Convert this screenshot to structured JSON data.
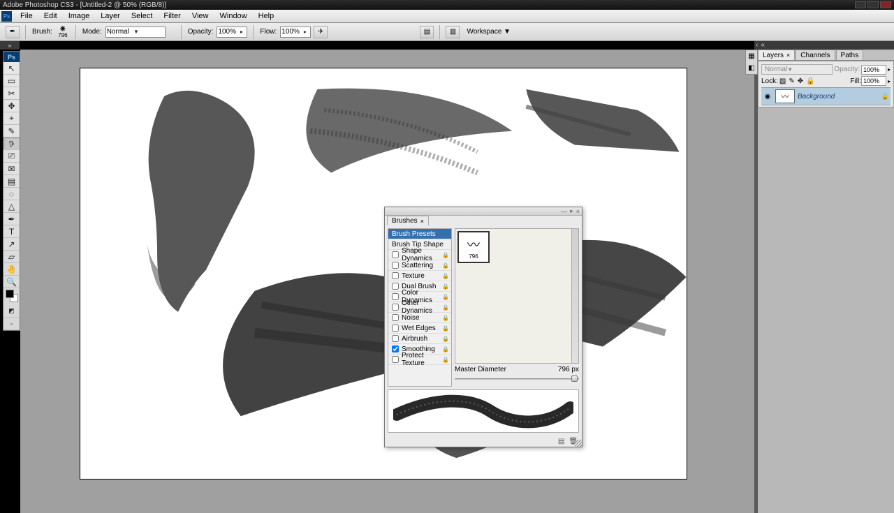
{
  "window": {
    "title": "Adobe Photoshop CS3 - [Untitled-2 @ 50% (RGB/8)]"
  },
  "menu": {
    "items": [
      "File",
      "Edit",
      "Image",
      "Layer",
      "Select",
      "Filter",
      "View",
      "Window",
      "Help"
    ]
  },
  "options": {
    "brush_label": "Brush:",
    "brush_size": "796",
    "mode_label": "Mode:",
    "mode_value": "Normal",
    "opacity_label": "Opacity:",
    "opacity_value": "100%",
    "flow_label": "Flow:",
    "flow_value": "100%",
    "workspace_label": "Workspace"
  },
  "toolbox": {
    "head": "Ps",
    "tools": [
      "↖",
      "▭",
      "✂",
      "✥",
      "⌖",
      "✎",
      "𖠚",
      "⎚",
      "✉",
      "▤",
      "◌",
      "△",
      "✒",
      "T",
      "↗",
      "▱",
      "🤚",
      "🔍"
    ],
    "selected_index": 6
  },
  "layers_panel": {
    "tabs": [
      "Layers",
      "Channels",
      "Paths"
    ],
    "blend_mode": "Normal",
    "opacity_label": "Opacity:",
    "opacity_value": "100%",
    "lock_label": "Lock:",
    "fill_label": "Fill:",
    "fill_value": "100%",
    "layer_name": "Background"
  },
  "brushes_panel": {
    "tab": "Brushes",
    "categories": [
      {
        "label": "Brush Presets",
        "checkbox": false,
        "selected": true,
        "lock": false
      },
      {
        "label": "Brush Tip Shape",
        "checkbox": false,
        "selected": false,
        "lock": false
      },
      {
        "label": "Shape Dynamics",
        "checkbox": true,
        "checked": false,
        "lock": true
      },
      {
        "label": "Scattering",
        "checkbox": true,
        "checked": false,
        "lock": true
      },
      {
        "label": "Texture",
        "checkbox": true,
        "checked": false,
        "lock": true
      },
      {
        "label": "Dual Brush",
        "checkbox": true,
        "checked": false,
        "lock": true
      },
      {
        "label": "Color Dynamics",
        "checkbox": true,
        "checked": false,
        "lock": true
      },
      {
        "label": "Other Dynamics",
        "checkbox": true,
        "checked": false,
        "lock": true
      },
      {
        "label": "Noise",
        "checkbox": true,
        "checked": false,
        "lock": true
      },
      {
        "label": "Wet Edges",
        "checkbox": true,
        "checked": false,
        "lock": true
      },
      {
        "label": "Airbrush",
        "checkbox": true,
        "checked": false,
        "lock": true
      },
      {
        "label": "Smoothing",
        "checkbox": true,
        "checked": true,
        "lock": true
      },
      {
        "label": "Protect Texture",
        "checkbox": true,
        "checked": false,
        "lock": true
      }
    ],
    "thumb_label": "796",
    "master_diameter_label": "Master Diameter",
    "master_diameter_value": "796 px"
  }
}
